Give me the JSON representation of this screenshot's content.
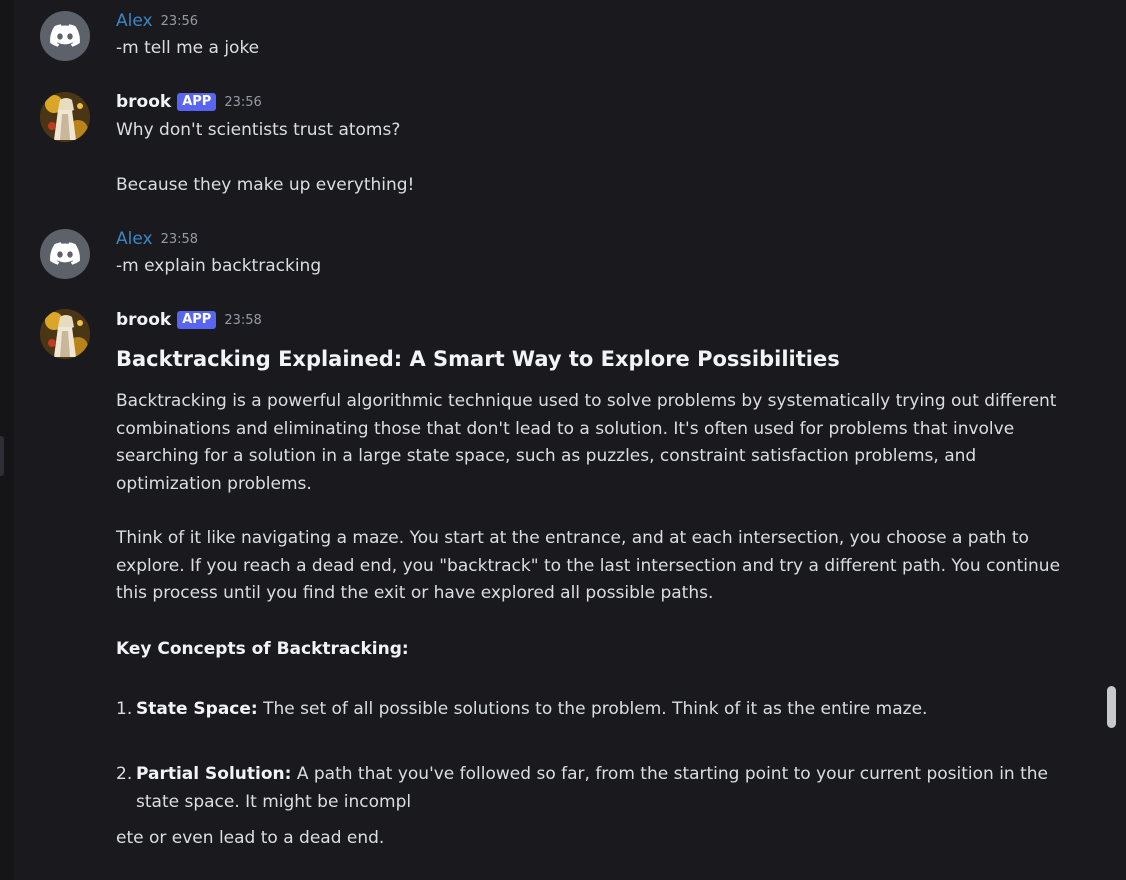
{
  "messages": [
    {
      "author": "Alex",
      "time": "23:56",
      "text": "-m tell me a joke"
    },
    {
      "author": "brook",
      "badge": "APP",
      "time": "23:56",
      "lines": [
        "Why don't scientists trust atoms?",
        "Because they make up everything!"
      ]
    },
    {
      "author": "Alex",
      "time": "23:58",
      "text": "-m explain backtracking"
    },
    {
      "author": "brook",
      "badge": "APP",
      "time": "23:58",
      "heading": "Backtracking Explained: A Smart Way to Explore Possibilities",
      "para1": "Backtracking is a powerful algorithmic technique used to solve problems by systematically trying out different combinations and eliminating those that don't lead to a solution. It's often used for problems that involve searching for a solution in a large state space, such as puzzles, constraint satisfaction problems, and optimization problems.",
      "para2": "Think of it like navigating a maze. You start at the entrance, and at each intersection, you choose a path to explore. If you reach a dead end, you \"backtrack\" to the last intersection and try a different path.  You continue this process until you find the exit or have explored all possible paths.",
      "key_concepts": "Key Concepts of Backtracking:",
      "items": [
        {
          "num": "1.",
          "term": "State Space:",
          "desc": " The set of all possible solutions to the problem. Think of it as the entire maze."
        },
        {
          "num": "2.",
          "term": "Partial Solution:",
          "desc": "  A path that you've followed so far, from the starting point to your current position in the state space. It might be incompl"
        }
      ],
      "trailing": "ete or even lead to a dead end."
    }
  ],
  "colors": {
    "background": "#1a1a1e",
    "alex_name": "#3d86c4",
    "app_badge": "#5865f2",
    "timestamp": "#949ba4"
  },
  "icons": {
    "alex_avatar": "discord-logo-icon",
    "brook_avatar": "brook-avatar-image"
  }
}
